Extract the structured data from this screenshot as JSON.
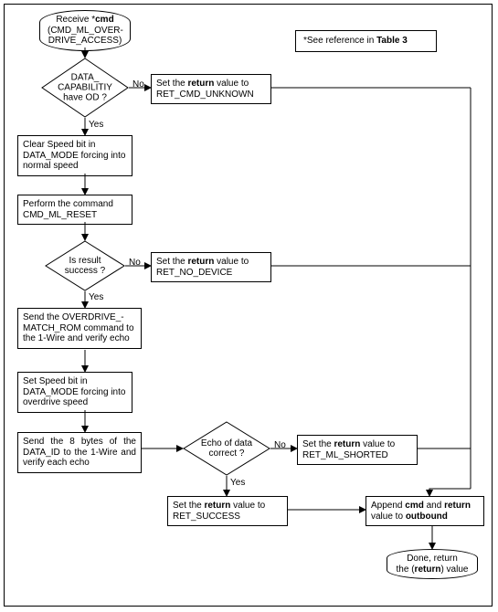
{
  "note": {
    "text_prefix": "*See reference in ",
    "table_ref": "Table 3"
  },
  "start": {
    "line1_prefix": "Receive *",
    "line1_bold": "cmd",
    "line2": "(CMD_ML_OVER-",
    "line3": "DRIVE_ACCESS)"
  },
  "d1": {
    "label": "DATA_ CAPABILITIY have OD ?",
    "no": "No",
    "yes": "Yes"
  },
  "r1": {
    "prefix": "Set the ",
    "ret": "return",
    "mid": " value to",
    "val": "RET_CMD_UNKNOWN"
  },
  "p1": {
    "text": "Clear Speed bit in DATA_MODE forcing into normal speed"
  },
  "p2": {
    "text": "Perform the command CMD_ML_RESET"
  },
  "d2": {
    "label": "Is result success ?",
    "no": "No",
    "yes": "Yes"
  },
  "r2": {
    "prefix": "Set the ",
    "ret": "return",
    "mid": " value to",
    "val": "RET_NO_DEVICE"
  },
  "p3": {
    "text": "Send the OVERDRIVE_- MATCH_ROM command  to the 1-Wire and verify echo"
  },
  "p4": {
    "text": "Set Speed bit in DATA_MODE forcing into overdrive speed"
  },
  "p5": {
    "text": "Send the 8 bytes of the DATA_ID to the 1-Wire and verify each echo"
  },
  "d3": {
    "label": "Echo of data correct ?",
    "no": "No",
    "yes": "Yes"
  },
  "r3": {
    "prefix": "Set the ",
    "ret": "return",
    "mid": " value to",
    "val": "RET_ML_SHORTED"
  },
  "r4": {
    "prefix": "Set the ",
    "ret": "return",
    "mid": " value to",
    "val": "RET_SUCCESS"
  },
  "append": {
    "t1": "Append ",
    "cmd": "cmd",
    "t2": " and ",
    "ret": "return",
    "t3": " value to ",
    "out": "outbound"
  },
  "done": {
    "line1": "Done, return",
    "line2_pre": "the (",
    "ret": "return",
    "line2_post": ") value"
  }
}
